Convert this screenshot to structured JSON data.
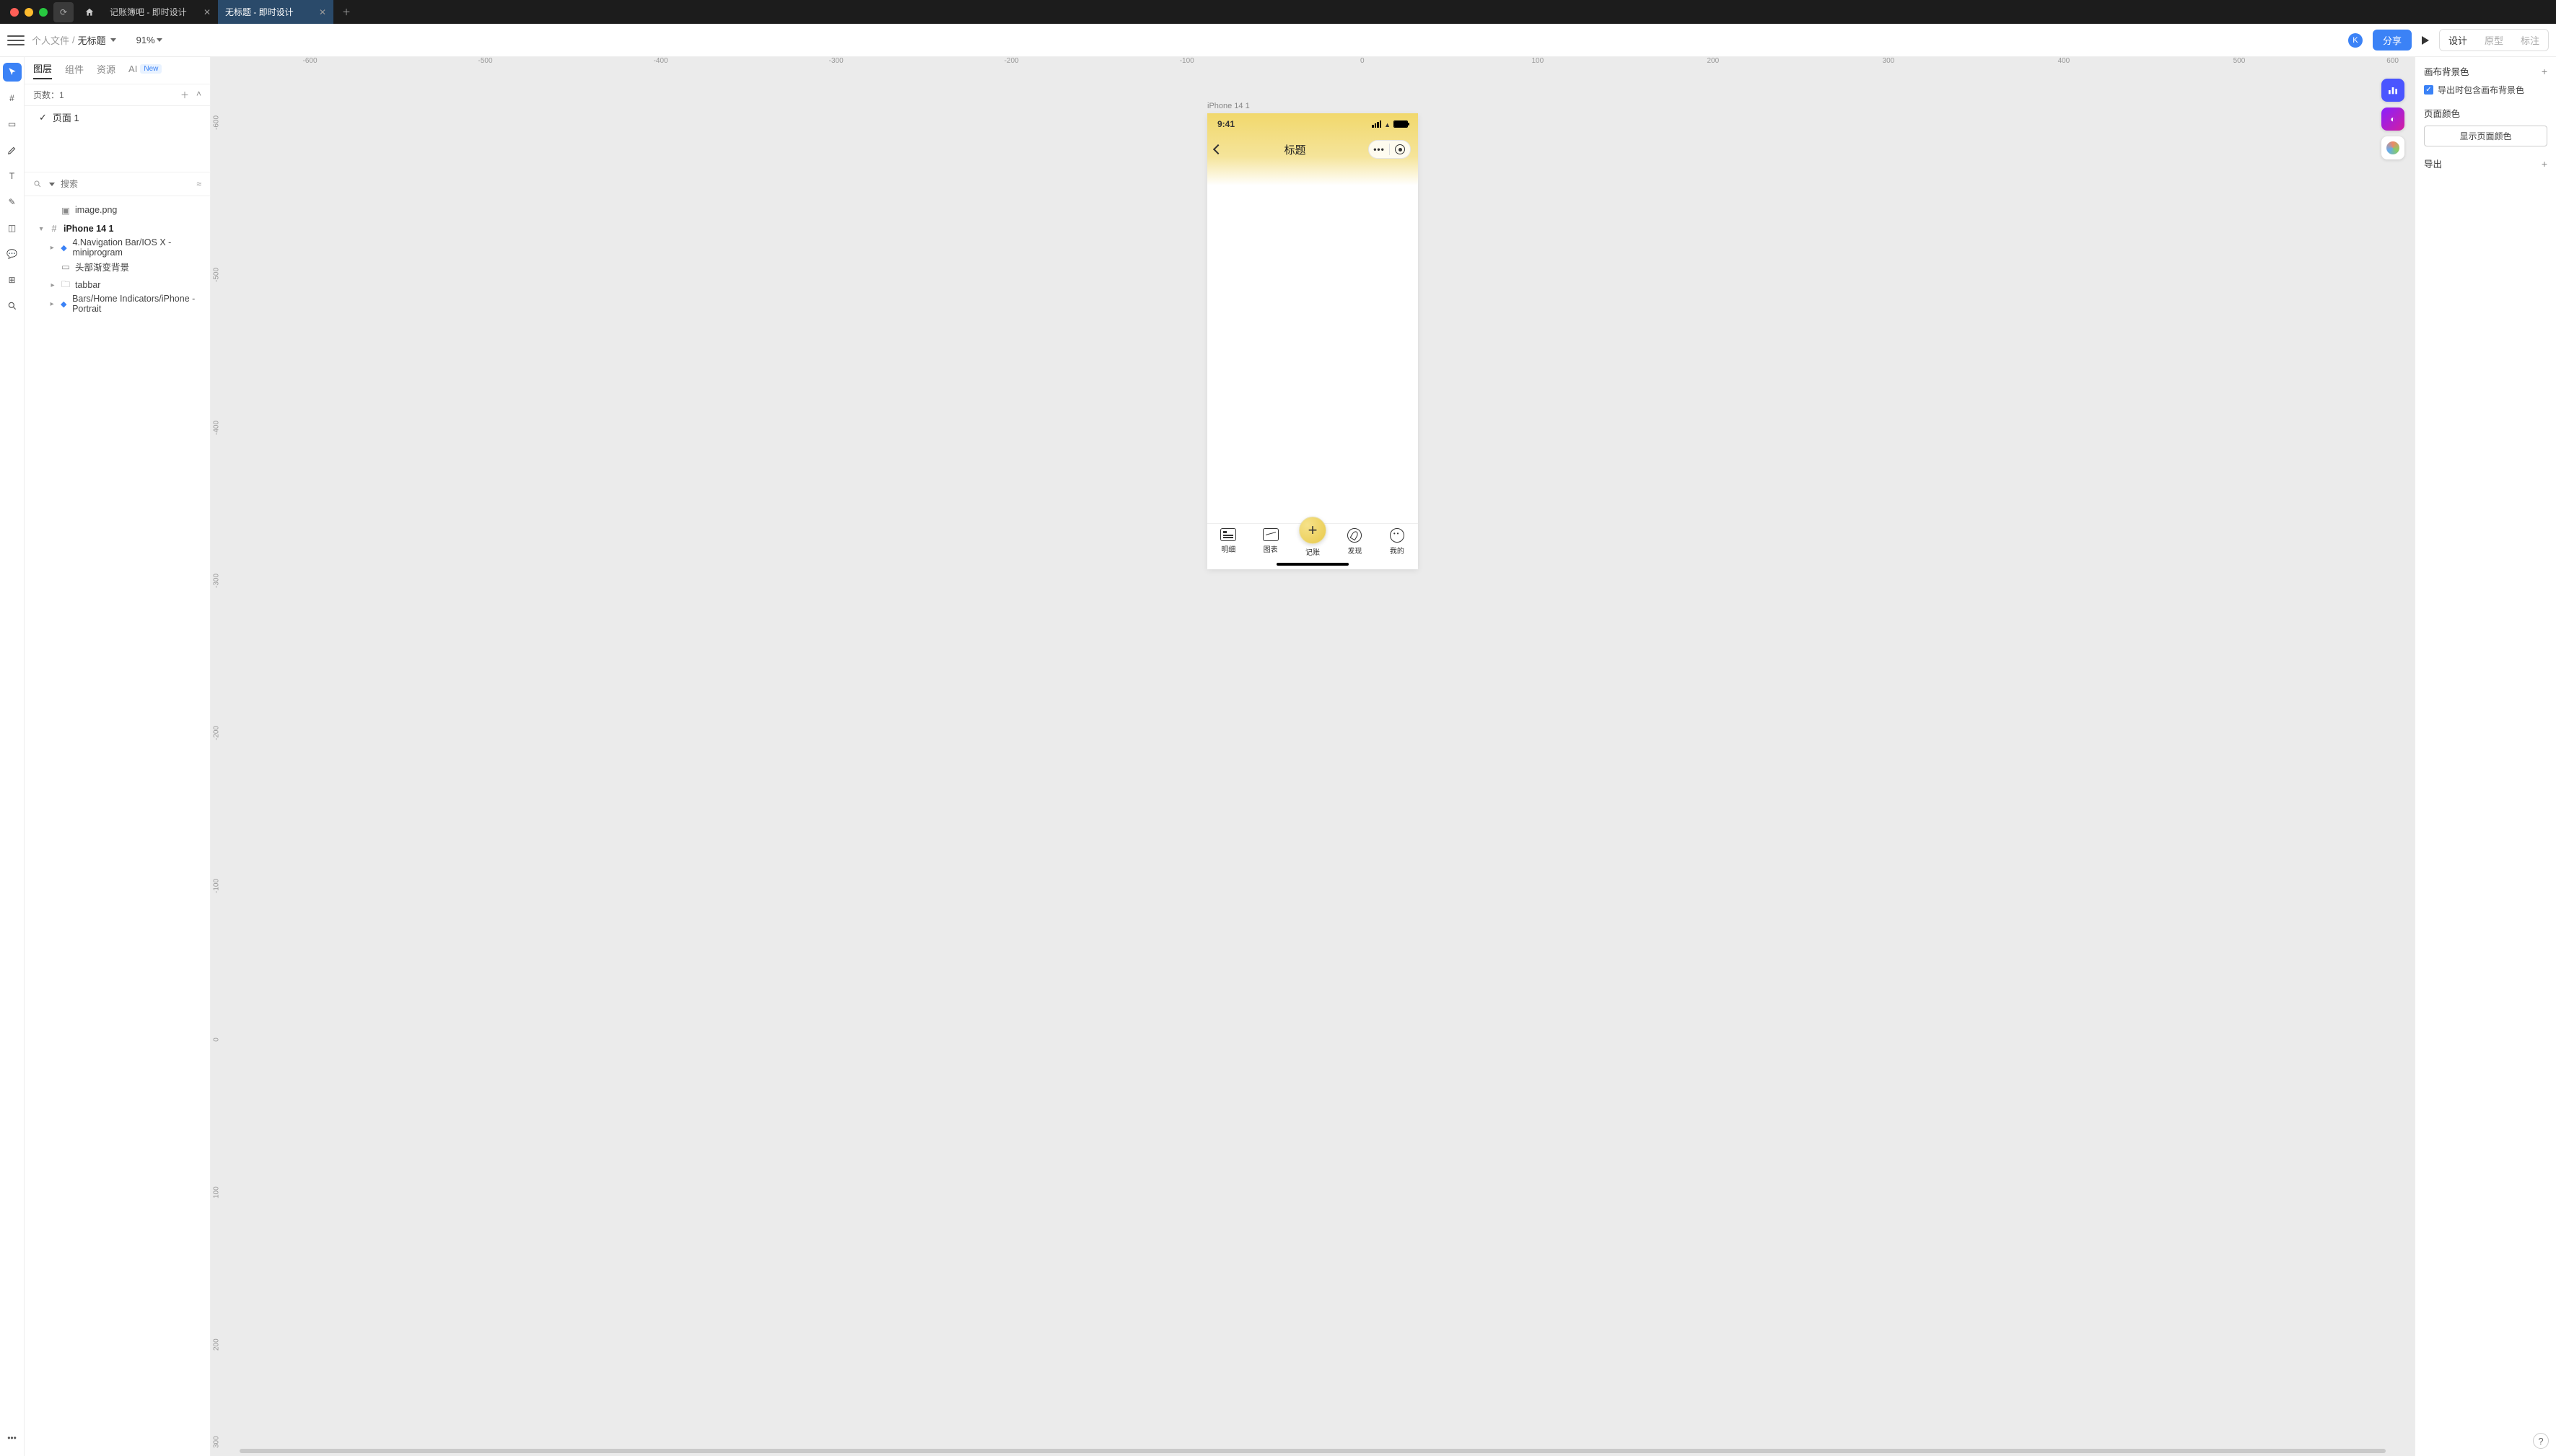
{
  "titlebar": {
    "tabs": [
      {
        "label": "记账簿吧 - 即时设计",
        "active": false
      },
      {
        "label": "无标题 - 即时设计",
        "active": true
      }
    ]
  },
  "breadcrumb": {
    "root": "个人文件",
    "sep": "/",
    "file": "无标题"
  },
  "zoom": "91%",
  "avatar": "K",
  "share": "分享",
  "modes": {
    "design": "设计",
    "prototype": "原型",
    "annotate": "标注"
  },
  "leftTabs": {
    "layers": "图层",
    "components": "组件",
    "assets": "资源",
    "ai": "AI",
    "new": "New"
  },
  "pages": {
    "headerLabel": "页数：",
    "count": "1",
    "page1": "页面 1"
  },
  "search": {
    "placeholder": "搜索"
  },
  "layers": {
    "image": "image.png",
    "frame": "iPhone 14 1",
    "nav": "4.Navigation Bar/IOS X - miniprogram",
    "gradient": "头部渐变背景",
    "tabbar": "tabbar",
    "homeind": "Bars/Home Indicators/iPhone - Portrait"
  },
  "artboardLabel": "iPhone 14 1",
  "phone": {
    "time": "9:41",
    "title": "标题",
    "tabs": {
      "detail": "明细",
      "chart": "图表",
      "add": "记账",
      "discover": "发现",
      "me": "我的"
    }
  },
  "ruler": {
    "h": [
      "-600",
      "-500",
      "-400",
      "-300",
      "-200",
      "-100",
      "0",
      "100",
      "200",
      "300",
      "400",
      "500",
      "600"
    ],
    "v": [
      "-600",
      "-500",
      "-400",
      "-300",
      "-200",
      "-100",
      "0",
      "100",
      "200",
      "300"
    ]
  },
  "rightPanel": {
    "bgHeader": "画布背景色",
    "includeBg": "导出时包含画布背景色",
    "pageColorHeader": "页面颜色",
    "showPageColor": "显示页面颜色",
    "exportHeader": "导出"
  }
}
